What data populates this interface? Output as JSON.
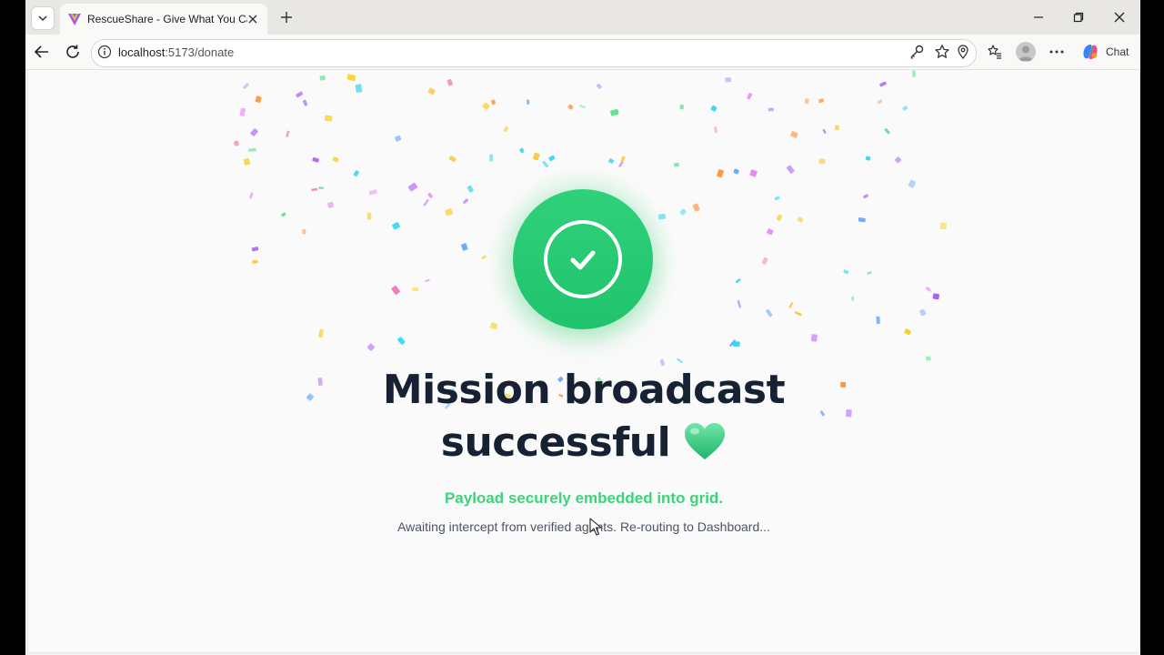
{
  "browser": {
    "tab_title": "RescueShare - Give What You Can",
    "url_host": "localhost",
    "url_path": ":5173/donate",
    "chat_label": "Chat"
  },
  "page": {
    "headline_line1": "Mission broadcast",
    "headline_line2": "successful",
    "subtitle": "Payload securely embedded into grid.",
    "note": "Awaiting intercept from verified agents. Re-routing to Dashboard..."
  },
  "colors": {
    "success_green": "#22c55e",
    "headline": "#162233",
    "subtitle": "#3fd27a"
  },
  "icons": [
    "chevron-down-icon",
    "favicon-icon",
    "close-icon",
    "plus-icon",
    "minimize-icon",
    "restore-icon",
    "back-icon",
    "reload-icon",
    "info-icon",
    "key-icon",
    "star-icon",
    "location-icon",
    "favorites-icon",
    "profile-icon",
    "more-icon",
    "copilot-icon",
    "check-icon",
    "green-heart-icon",
    "cursor-icon"
  ]
}
